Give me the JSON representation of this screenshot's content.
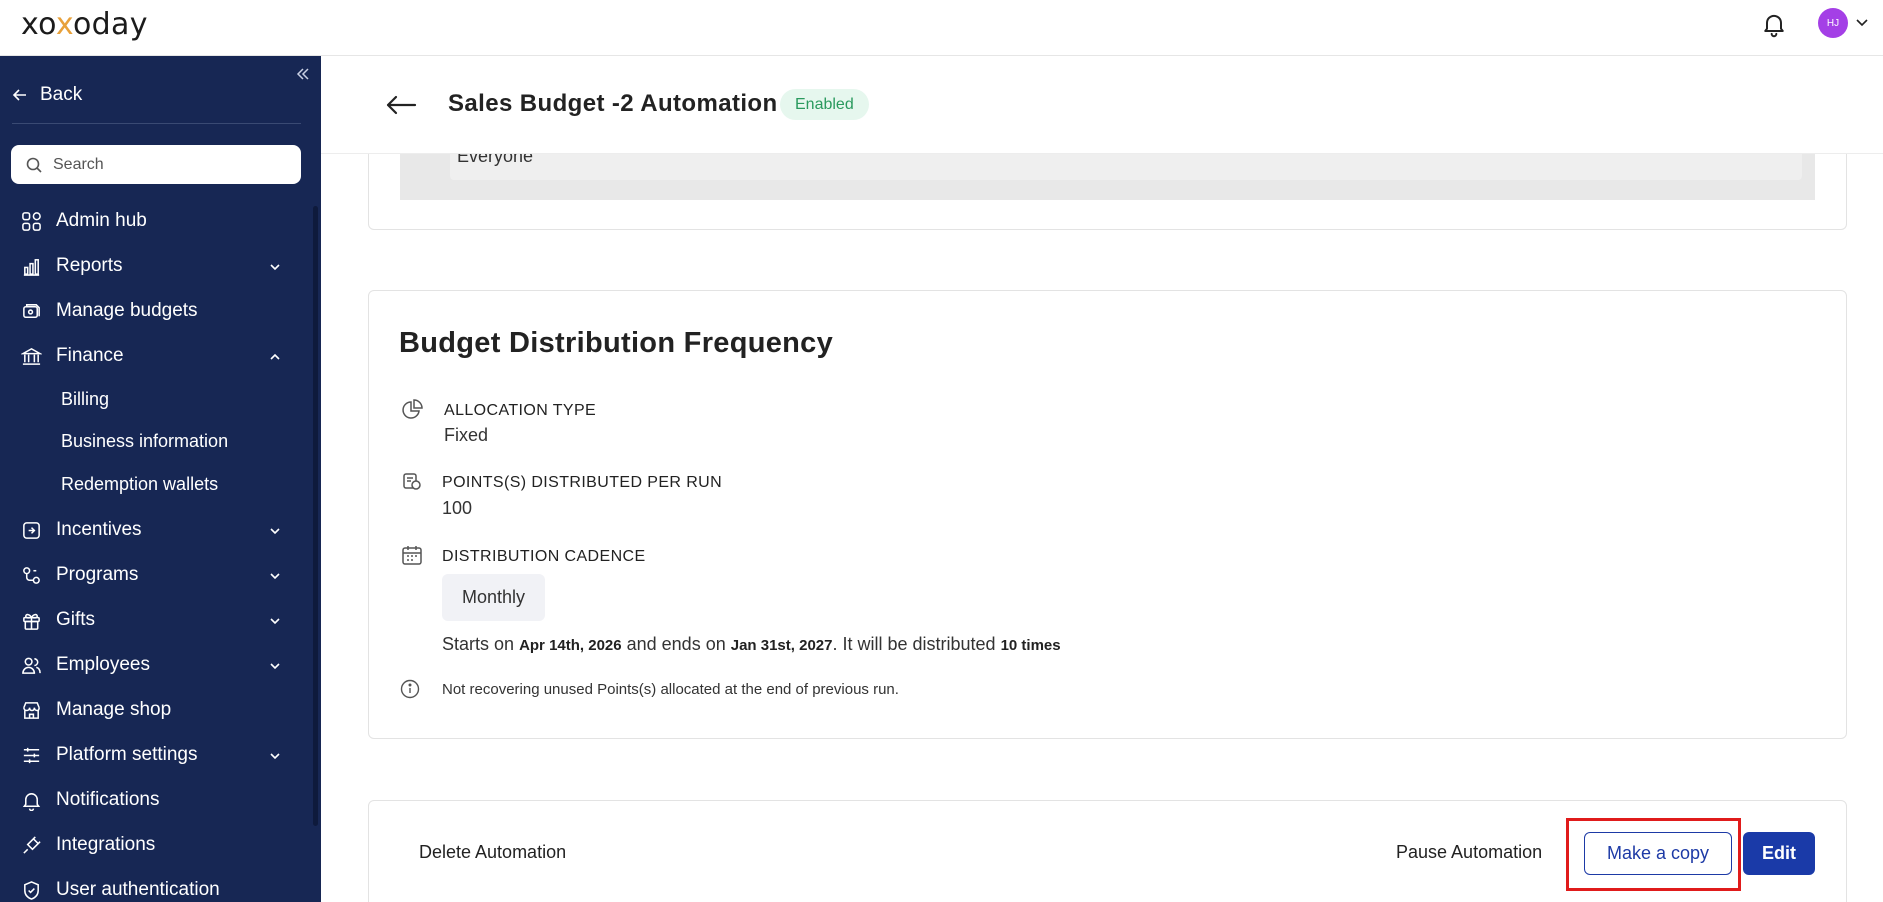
{
  "topbar": {
    "logo_prefix": "xo",
    "logo_x": "x",
    "logo_suffix": "oday",
    "avatar_initials": "HJ"
  },
  "sidebar": {
    "back_label": "Back",
    "search_placeholder": "Search",
    "items": [
      {
        "label": "Admin hub",
        "icon": "grid-icon"
      },
      {
        "label": "Reports",
        "icon": "bar-chart-icon",
        "expandable": true
      },
      {
        "label": "Manage budgets",
        "icon": "budget-icon"
      },
      {
        "label": "Finance",
        "icon": "bank-icon",
        "expanded": true
      },
      {
        "label": "Incentives",
        "icon": "incentive-icon",
        "expandable": true
      },
      {
        "label": "Programs",
        "icon": "programs-icon",
        "expandable": true
      },
      {
        "label": "Gifts",
        "icon": "gift-icon",
        "expandable": true
      },
      {
        "label": "Employees",
        "icon": "users-icon",
        "expandable": true
      },
      {
        "label": "Manage shop",
        "icon": "shop-icon"
      },
      {
        "label": "Platform settings",
        "icon": "sliders-icon",
        "expandable": true
      },
      {
        "label": "Notifications",
        "icon": "bell-icon"
      },
      {
        "label": "Integrations",
        "icon": "plug-icon"
      },
      {
        "label": "User authentication",
        "icon": "shield-icon"
      }
    ],
    "finance_sub": [
      "Billing",
      "Business information",
      "Redemption wallets"
    ]
  },
  "header": {
    "title": "Sales Budget -2 Automation",
    "status": "Enabled"
  },
  "top_card": {
    "value": "Everyone"
  },
  "frequency": {
    "title": "Budget Distribution Frequency",
    "allocation_label": "ALLOCATION TYPE",
    "allocation_value": "Fixed",
    "points_label": "POINTS(S) DISTRIBUTED PER RUN",
    "points_value": "100",
    "cadence_label": "DISTRIBUTION CADENCE",
    "cadence_value": "Monthly",
    "dates_prefix": "Starts on",
    "start_date": "Apr 14th, 2026",
    "dates_mid": "and ends on",
    "end_date": "Jan 31st, 2027",
    "dates_suffix": ". It will be distributed",
    "times": "10 times",
    "note": "Not recovering unused Points(s) allocated at the end of previous run."
  },
  "actions": {
    "delete": "Delete Automation",
    "pause": "Pause Automation",
    "copy": "Make a copy",
    "edit": "Edit"
  },
  "colors": {
    "sidebar_bg": "#172754",
    "primary": "#1a3aa8",
    "badge_text": "#2a9a5e",
    "badge_bg": "#e6f7ee",
    "highlight": "#e01b1b",
    "avatar": "#a43fe6"
  }
}
